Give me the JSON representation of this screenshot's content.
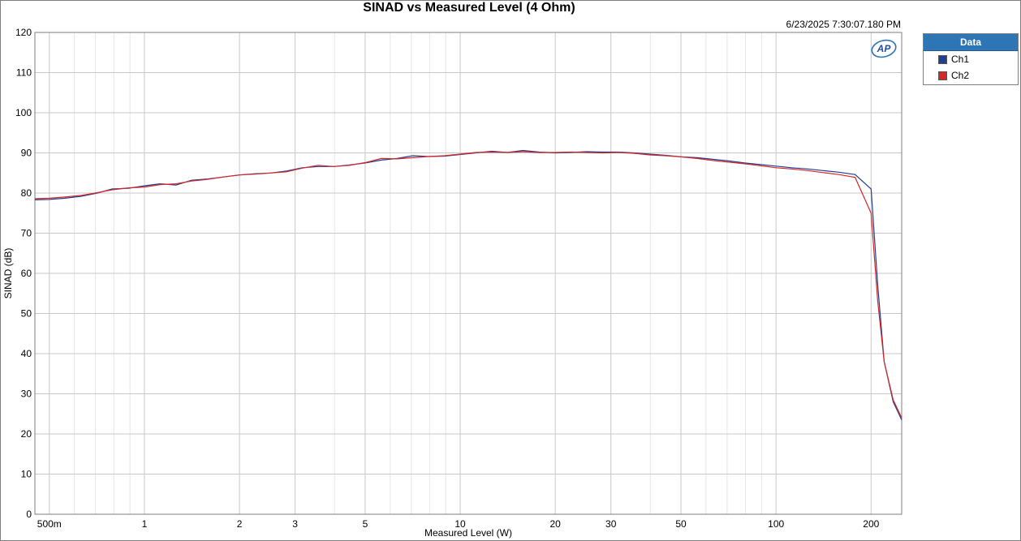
{
  "chart_data": {
    "type": "line",
    "title": "SINAD vs Measured Level (4 Ohm)",
    "timestamp": "6/23/2025 7:30:07.180 PM",
    "xlabel": "Measured Level (W)",
    "ylabel": "SINAD (dB)",
    "x_scale": "log",
    "xlim": [
      0.45,
      250
    ],
    "ylim": [
      0,
      120
    ],
    "x_ticks": [
      {
        "value": 0.5,
        "label": "500m"
      },
      {
        "value": 1,
        "label": "1"
      },
      {
        "value": 2,
        "label": "2"
      },
      {
        "value": 3,
        "label": "3"
      },
      {
        "value": 5,
        "label": "5"
      },
      {
        "value": 10,
        "label": "10"
      },
      {
        "value": 20,
        "label": "20"
      },
      {
        "value": 30,
        "label": "30"
      },
      {
        "value": 50,
        "label": "50"
      },
      {
        "value": 100,
        "label": "100"
      },
      {
        "value": 200,
        "label": "200"
      }
    ],
    "y_ticks": [
      0,
      10,
      20,
      30,
      40,
      50,
      60,
      70,
      80,
      90,
      100,
      110,
      120
    ],
    "grid": true,
    "legend": {
      "title": "Data",
      "placement": "right"
    },
    "series": [
      {
        "name": "Ch1",
        "color": "#1f3f8f",
        "points": [
          [
            0.45,
            78.3
          ],
          [
            0.5,
            78.4
          ],
          [
            0.56,
            78.7
          ],
          [
            0.63,
            79.2
          ],
          [
            0.71,
            80.0
          ],
          [
            0.79,
            81.0
          ],
          [
            0.89,
            81.2
          ],
          [
            1.0,
            81.8
          ],
          [
            1.12,
            82.3
          ],
          [
            1.26,
            82.0
          ],
          [
            1.41,
            83.2
          ],
          [
            1.58,
            83.5
          ],
          [
            1.78,
            84.0
          ],
          [
            2.0,
            84.5
          ],
          [
            2.24,
            84.8
          ],
          [
            2.51,
            85.0
          ],
          [
            2.82,
            85.5
          ],
          [
            3.16,
            86.3
          ],
          [
            3.55,
            86.6
          ],
          [
            3.98,
            86.6
          ],
          [
            4.47,
            87.0
          ],
          [
            5.01,
            87.5
          ],
          [
            5.62,
            88.2
          ],
          [
            6.31,
            88.6
          ],
          [
            7.08,
            89.3
          ],
          [
            7.94,
            89.1
          ],
          [
            8.91,
            89.2
          ],
          [
            10.0,
            89.6
          ],
          [
            11.2,
            90.0
          ],
          [
            12.6,
            90.4
          ],
          [
            14.1,
            90.1
          ],
          [
            15.8,
            90.6
          ],
          [
            17.8,
            90.2
          ],
          [
            20.0,
            90.0
          ],
          [
            22.4,
            90.1
          ],
          [
            25.1,
            90.3
          ],
          [
            28.2,
            90.2
          ],
          [
            31.6,
            90.2
          ],
          [
            35.5,
            90.0
          ],
          [
            39.8,
            89.7
          ],
          [
            44.7,
            89.4
          ],
          [
            50.1,
            89.0
          ],
          [
            56.2,
            88.8
          ],
          [
            63.1,
            88.4
          ],
          [
            70.8,
            88.0
          ],
          [
            79.4,
            87.5
          ],
          [
            89.1,
            87.1
          ],
          [
            100,
            86.7
          ],
          [
            112,
            86.3
          ],
          [
            126,
            86.0
          ],
          [
            141,
            85.6
          ],
          [
            158,
            85.2
          ],
          [
            178,
            84.6
          ],
          [
            200,
            81.0
          ],
          [
            210,
            57.0
          ],
          [
            220,
            38.0
          ],
          [
            235,
            28.0
          ],
          [
            250,
            23.5
          ]
        ]
      },
      {
        "name": "Ch2",
        "color": "#d62728",
        "points": [
          [
            0.45,
            78.6
          ],
          [
            0.5,
            78.7
          ],
          [
            0.56,
            79.0
          ],
          [
            0.63,
            79.4
          ],
          [
            0.71,
            80.1
          ],
          [
            0.79,
            80.8
          ],
          [
            0.89,
            81.3
          ],
          [
            1.0,
            81.5
          ],
          [
            1.12,
            82.1
          ],
          [
            1.26,
            82.3
          ],
          [
            1.41,
            83.0
          ],
          [
            1.58,
            83.4
          ],
          [
            1.78,
            84.0
          ],
          [
            2.0,
            84.5
          ],
          [
            2.24,
            84.7
          ],
          [
            2.51,
            85.0
          ],
          [
            2.82,
            85.3
          ],
          [
            3.16,
            86.2
          ],
          [
            3.55,
            86.9
          ],
          [
            3.98,
            86.6
          ],
          [
            4.47,
            86.9
          ],
          [
            5.01,
            87.6
          ],
          [
            5.62,
            88.6
          ],
          [
            6.31,
            88.5
          ],
          [
            7.08,
            88.8
          ],
          [
            7.94,
            89.1
          ],
          [
            8.91,
            89.3
          ],
          [
            10.0,
            89.7
          ],
          [
            11.2,
            90.1
          ],
          [
            12.6,
            90.2
          ],
          [
            14.1,
            90.1
          ],
          [
            15.8,
            90.3
          ],
          [
            17.8,
            90.1
          ],
          [
            20.0,
            90.1
          ],
          [
            22.4,
            90.2
          ],
          [
            25.1,
            90.1
          ],
          [
            28.2,
            90.0
          ],
          [
            31.6,
            90.1
          ],
          [
            35.5,
            89.9
          ],
          [
            39.8,
            89.5
          ],
          [
            44.7,
            89.3
          ],
          [
            50.1,
            89.0
          ],
          [
            56.2,
            88.6
          ],
          [
            63.1,
            88.1
          ],
          [
            70.8,
            87.7
          ],
          [
            79.4,
            87.3
          ],
          [
            89.1,
            86.8
          ],
          [
            100,
            86.3
          ],
          [
            112,
            86.0
          ],
          [
            126,
            85.6
          ],
          [
            141,
            85.1
          ],
          [
            158,
            84.6
          ],
          [
            178,
            83.9
          ],
          [
            200,
            75.0
          ],
          [
            210,
            53.0
          ],
          [
            220,
            38.0
          ],
          [
            235,
            28.5
          ],
          [
            250,
            24.0
          ]
        ]
      }
    ]
  }
}
